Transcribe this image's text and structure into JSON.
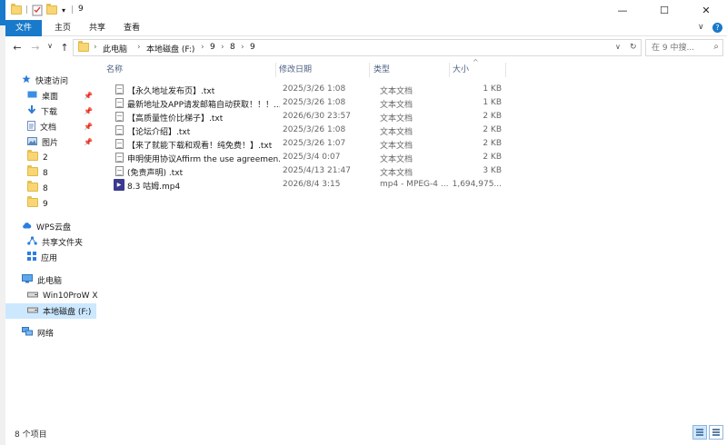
{
  "window": {
    "title": "9",
    "controls": {
      "minimize": "—",
      "maximize": "☐",
      "close": "✕"
    }
  },
  "ribbon": {
    "tabs": [
      {
        "label": "文件",
        "active": true
      },
      {
        "label": "主页",
        "active": false
      },
      {
        "label": "共享",
        "active": false
      },
      {
        "label": "查看",
        "active": false
      }
    ],
    "expand_icon": "chevron-down-icon",
    "help_icon": "help-icon",
    "accent": "#1979ca"
  },
  "address": {
    "back": "←",
    "forward": "→",
    "recent": "∨",
    "up": "↑",
    "path": [
      "此电脑",
      "本地磁盘 (F:)",
      "9",
      "8",
      "9"
    ],
    "refresh": "↻",
    "dropdown": "∨"
  },
  "search": {
    "placeholder": "在 9 中搜..."
  },
  "nav": {
    "items": [
      {
        "label": "快速访问",
        "icon": "star-icon"
      },
      {
        "label": "桌面",
        "icon": "desktop-icon",
        "pinned": true
      },
      {
        "label": "下载",
        "icon": "download-icon",
        "pinned": true
      },
      {
        "label": "文档",
        "icon": "document-icon",
        "pinned": true
      },
      {
        "label": "图片",
        "icon": "picture-icon",
        "pinned": true
      },
      {
        "label": "2",
        "icon": "folder-icon"
      },
      {
        "label": "8",
        "icon": "folder-icon"
      },
      {
        "label": "8",
        "icon": "folder-icon"
      },
      {
        "label": "9",
        "icon": "folder-icon"
      },
      {
        "label": "WPS云盘",
        "icon": "cloud-icon"
      },
      {
        "label": "共享文件夹",
        "icon": "share-folder-icon"
      },
      {
        "label": "应用",
        "icon": "apps-icon"
      },
      {
        "label": "此电脑",
        "icon": "computer-icon"
      },
      {
        "label": "Win10ProW X",
        "icon": "drive-icon"
      },
      {
        "label": "本地磁盘 (F:)",
        "icon": "drive-icon",
        "selected": true
      },
      {
        "label": "网络",
        "icon": "network-icon"
      }
    ]
  },
  "columns": {
    "name": "名称",
    "date": "修改日期",
    "type": "类型",
    "size": "大小"
  },
  "files": [
    {
      "name": "【永久地址发布页】.txt",
      "date": "2025/3/26 1:08",
      "type": "文本文档",
      "size": "1 KB",
      "icon": "txt-file-icon"
    },
    {
      "name": "最新地址及APP请发邮箱自动获取！！！....",
      "date": "2025/3/26 1:08",
      "type": "文本文档",
      "size": "1 KB",
      "icon": "txt-file-icon"
    },
    {
      "name": "【高质量性价比梯子】.txt",
      "date": "2026/6/30 23:57",
      "type": "文本文档",
      "size": "2 KB",
      "icon": "txt-file-icon"
    },
    {
      "name": "【论坛介绍】.txt",
      "date": "2025/3/26 1:08",
      "type": "文本文档",
      "size": "2 KB",
      "icon": "txt-file-icon"
    },
    {
      "name": "【来了就能下载和观看！纯免费！】.txt",
      "date": "2025/3/26 1:07",
      "type": "文本文档",
      "size": "2 KB",
      "icon": "txt-file-icon"
    },
    {
      "name": "申明使用协议Affirm the use agreemen...",
      "date": "2025/3/4 0:07",
      "type": "文本文档",
      "size": "2 KB",
      "icon": "txt-file-icon"
    },
    {
      "name": "(免责声明) .txt",
      "date": "2025/4/13 21:47",
      "type": "文本文档",
      "size": "3 KB",
      "icon": "txt-file-icon"
    },
    {
      "name": "8.3 咕姆.mp4",
      "date": "2026/8/4 3:15",
      "type": "mp4 - MPEG-4 ...",
      "size": "1,694,975...",
      "icon": "video-file-icon"
    }
  ],
  "status": {
    "count": "8 个项目"
  }
}
